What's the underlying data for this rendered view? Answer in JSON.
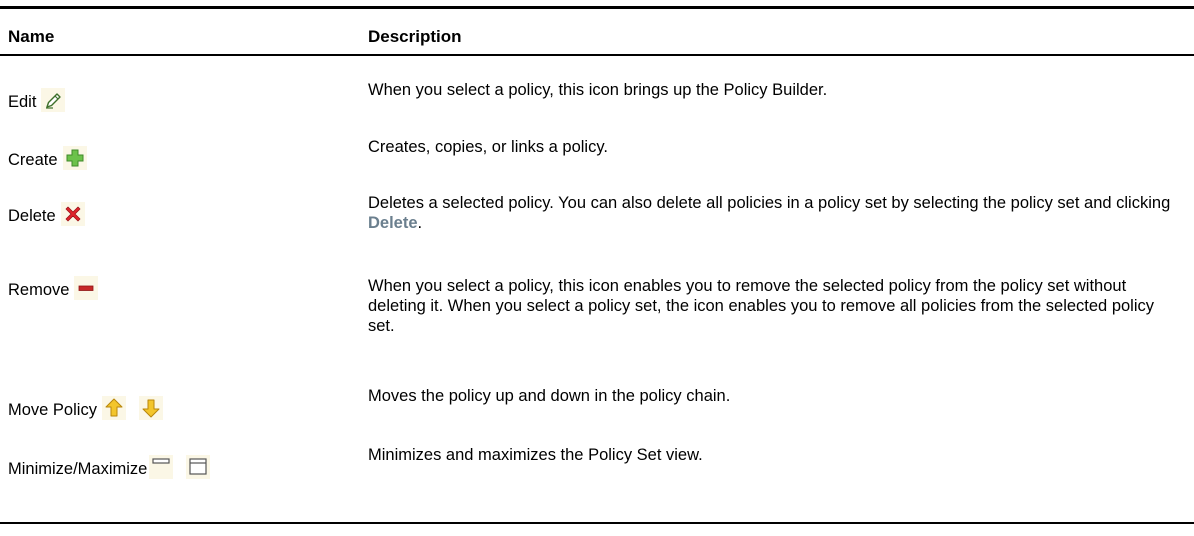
{
  "table": {
    "headers": {
      "name": "Name",
      "description": "Description"
    },
    "rows": [
      {
        "name": "Edit",
        "icons": [
          "pencil-icon"
        ],
        "description": "When you select a policy, this icon brings up the Policy Builder."
      },
      {
        "name": "Create",
        "icons": [
          "plus-icon"
        ],
        "description": "Creates, copies, or links a policy."
      },
      {
        "name": "Delete",
        "icons": [
          "red-x-icon"
        ],
        "description_before": "Deletes a selected policy. You can also delete all policies in a policy set by selecting the policy set and clicking ",
        "description_ui": "Delete",
        "description_after": "."
      },
      {
        "name": "Remove",
        "icons": [
          "minus-icon"
        ],
        "description": "When you select a policy, this icon enables you to remove the selected policy from the policy set without deleting it. When you select a policy set, the icon enables you to remove all policies from the selected policy set."
      },
      {
        "name": "Move Policy",
        "icons": [
          "arrow-up-icon",
          "arrow-down-icon"
        ],
        "description": "Moves the policy up and down in the policy chain."
      },
      {
        "name": "Minimize/Maximize",
        "icons": [
          "minimize-icon",
          "maximize-icon"
        ],
        "description": "Minimizes and maximizes the Policy Set view."
      }
    ]
  },
  "colors": {
    "icon_background": "#fbf7e6",
    "ui_reference": "#6b7f8e",
    "create_green": "#6cc24a",
    "delete_red": "#e0242c",
    "remove_red": "#c62828",
    "arrow_yellow": "#f3c52b"
  }
}
